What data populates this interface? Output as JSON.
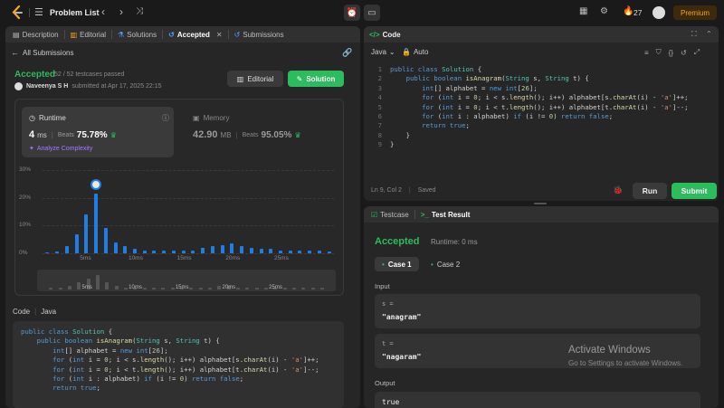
{
  "topbar": {
    "problem_list": "Problem List",
    "streak": "27",
    "premium": "Premium"
  },
  "left_tabs": [
    {
      "label": "Description"
    },
    {
      "label": "Editorial"
    },
    {
      "label": "Solutions"
    },
    {
      "label": "Accepted"
    },
    {
      "label": "Submissions"
    }
  ],
  "submission": {
    "back_label": "All Submissions",
    "status": "Accepted",
    "testcases": "52 / 52 testcases passed",
    "user": "Naveenya S H",
    "submitted_at": "submitted at Apr 17, 2025 22:15",
    "editorial_button": "Editorial",
    "solution_button": "Solution"
  },
  "runtime": {
    "label": "Runtime",
    "value": "4",
    "unit": "ms",
    "beats_label": "Beats",
    "beats": "75.78%",
    "analyze": "Analyze Complexity"
  },
  "memory": {
    "label": "Memory",
    "value": "42.90",
    "unit": "MB",
    "beats_label": "Beats",
    "beats": "95.05%"
  },
  "chart_data": {
    "type": "bar",
    "title": "",
    "xlabel": "",
    "ylabel": "",
    "ylim": [
      0,
      30
    ],
    "yticks": [
      "30%",
      "20%",
      "10%",
      "0%"
    ],
    "xticks": [
      "5ms",
      "10ms",
      "15ms",
      "20ms",
      "25ms"
    ],
    "highlight_index": 5,
    "values": [
      0.3,
      0.5,
      2.5,
      7,
      14,
      21.5,
      9,
      4,
      2.5,
      1.5,
      1,
      1,
      1,
      1,
      1,
      1,
      2,
      2.5,
      3,
      3.5,
      2.5,
      2,
      1.5,
      1.5,
      1,
      1,
      1,
      1,
      1,
      0.5
    ],
    "minimap_values": [
      1,
      1,
      2,
      4,
      6,
      8,
      4,
      2,
      1,
      1,
      1,
      1,
      1,
      1,
      1,
      1,
      1,
      1,
      2,
      2,
      1,
      1,
      1,
      1,
      1,
      1,
      1,
      1,
      1,
      1
    ],
    "minimap_ticks": [
      "5ms",
      "10ms",
      "15ms",
      "20ms",
      "25ms"
    ]
  },
  "bottom_code": {
    "label": "Code",
    "lang": "Java",
    "lines": [
      "public class Solution {",
      "    public boolean isAnagram(String s, String t) {",
      "        int[] alphabet = new int[26];",
      "        for (int i = 0; i < s.length(); i++) alphabet[s.charAt(i) - 'a']++;",
      "        for (int i = 0; i < t.length(); i++) alphabet[t.charAt(i) - 'a']--;",
      "        for (int i : alphabet) if (i != 0) return false;",
      "        return true;"
    ]
  },
  "editor": {
    "title": "Code",
    "lang": "Java",
    "auto": "Auto",
    "status_pos": "Ln 9, Col 2",
    "status_saved": "Saved",
    "run": "Run",
    "submit": "Submit",
    "line_numbers": [
      "1",
      "2",
      "3",
      "4",
      "5",
      "6",
      "7",
      "8",
      "9"
    ],
    "lines": [
      "public class Solution {",
      "    public boolean isAnagram(String s, String t) {",
      "        int[] alphabet = new int[26];",
      "        for (int i = 0; i < s.length(); i++) alphabet[s.charAt(i) - 'a']++;",
      "        for (int i = 0; i < t.length(); i++) alphabet[t.charAt(i) - 'a']--;",
      "        for (int i : alphabet) if (i != 0) return false;",
      "        return true;",
      "    }",
      "}"
    ]
  },
  "result": {
    "tab_testcase": "Testcase",
    "tab_result": "Test Result",
    "status": "Accepted",
    "runtime": "Runtime: 0 ms",
    "case1": "Case 1",
    "case2": "Case 2",
    "input_label": "Input",
    "s_label": "s =",
    "s_value": "\"anagram\"",
    "t_label": "t =",
    "t_value": "\"nagaram\"",
    "output_label": "Output",
    "output_value": "true"
  },
  "watermark": {
    "title": "Activate Windows",
    "sub": "Go to Settings to activate Windows."
  },
  "colors": {
    "accent_green": "#2cbb5d",
    "bar_blue": "#1f7de6",
    "premium": "#ffa116"
  }
}
